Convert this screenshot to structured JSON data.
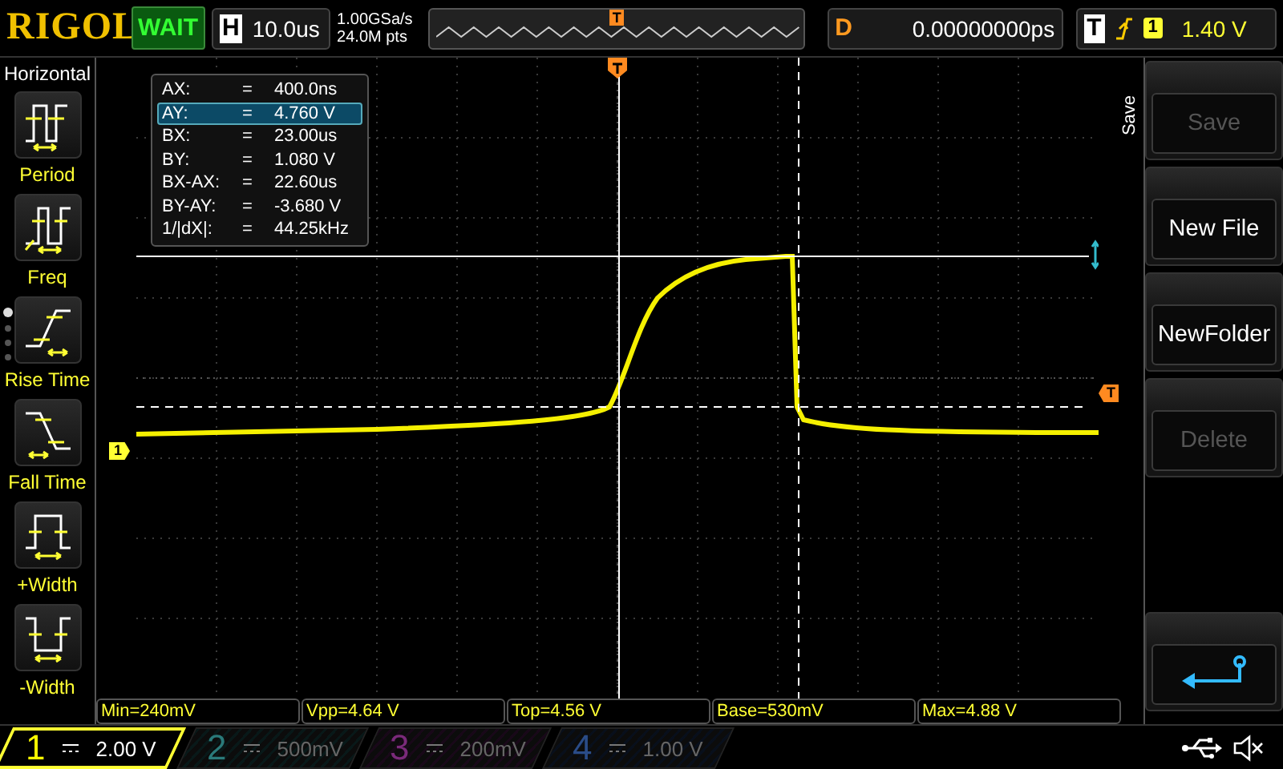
{
  "top_bar": {
    "brand": "RIGOL",
    "run_state": "WAIT",
    "horizontal": {
      "label": "H",
      "timebase": "10.0us"
    },
    "sample_rate": "1.00GSa/s",
    "memory_depth": "24.0M pts",
    "memory_marker": "T",
    "delay": {
      "label": "D",
      "value": "0.00000000ps"
    },
    "trigger": {
      "label": "T",
      "source": "1",
      "level": "1.40 V"
    }
  },
  "left_menu": {
    "title": "Horizontal",
    "pages": [
      {
        "selected": true
      },
      {
        "selected": false
      },
      {
        "selected": false
      },
      {
        "selected": false
      }
    ],
    "items": [
      {
        "kind": "period",
        "label": "Period"
      },
      {
        "kind": "freq",
        "label": "Freq"
      },
      {
        "kind": "rise",
        "label": "Rise Time"
      },
      {
        "kind": "fall",
        "label": "Fall Time"
      },
      {
        "kind": "pos_width",
        "label": "+Width"
      },
      {
        "kind": "neg_width",
        "label": "-Width"
      }
    ]
  },
  "cursor_readout": [
    {
      "label": "AX:",
      "equals": "=",
      "value": "400.0ns",
      "selected": false
    },
    {
      "label": "AY:",
      "equals": "=",
      "value": "4.760 V",
      "selected": true
    },
    {
      "label": "BX:",
      "equals": "=",
      "value": "23.00us",
      "selected": false
    },
    {
      "label": "BY:",
      "equals": "=",
      "value": "1.080 V",
      "selected": false
    },
    {
      "label": "BX-AX:",
      "equals": "=",
      "value": "22.60us",
      "selected": false
    },
    {
      "label": "BY-AY:",
      "equals": "=",
      "value": "-3.680 V",
      "selected": false
    },
    {
      "label": "1/|dX|:",
      "equals": "=",
      "value": "44.25kHz",
      "selected": false
    }
  ],
  "markers": {
    "channel": "1",
    "trigger": "T"
  },
  "right_menu": {
    "title": "Save",
    "buttons": [
      {
        "kind": "text",
        "label": "Save",
        "disabled": true
      },
      {
        "kind": "text",
        "label": "New File",
        "disabled": false
      },
      {
        "kind": "text",
        "label": "NewFolder",
        "disabled": false
      },
      {
        "kind": "text",
        "label": "Delete",
        "disabled": true
      },
      {
        "kind": "back"
      }
    ]
  },
  "measurements": [
    "Min=240mV",
    "Vpp=4.64 V",
    "Top=4.56 V",
    "Base=530mV",
    "Max=4.88 V"
  ],
  "channels": [
    {
      "number": "1",
      "scale": "2.00 V",
      "selected": true,
      "color": "#ffff00"
    },
    {
      "number": "2",
      "scale": "500mV",
      "selected": false,
      "color": "#2a7a7a"
    },
    {
      "number": "3",
      "scale": "200mV",
      "selected": false,
      "color": "#7a2a7a"
    },
    {
      "number": "4",
      "scale": "1.00 V",
      "selected": false,
      "color": "#2a4c88"
    }
  ]
}
